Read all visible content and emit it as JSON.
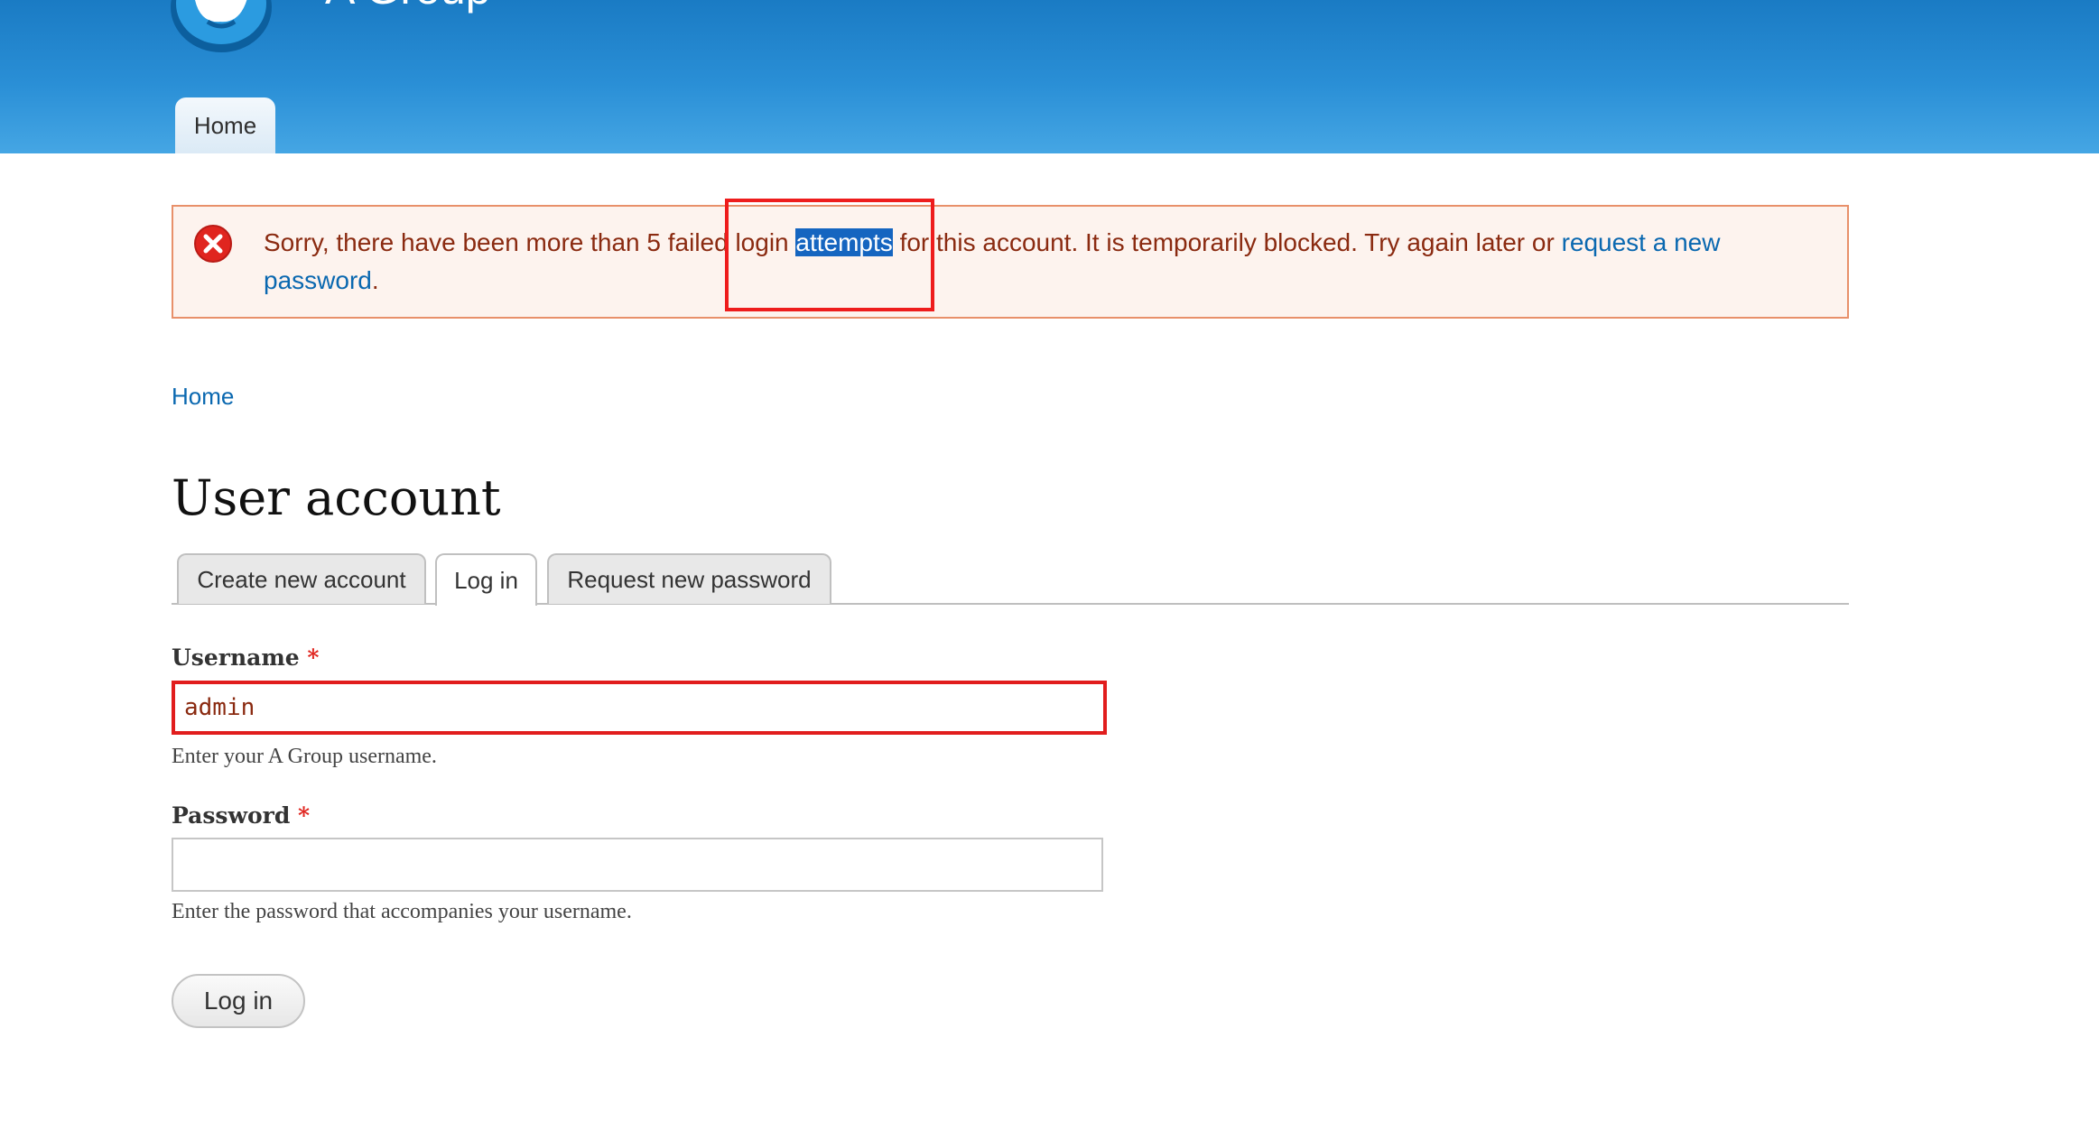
{
  "header": {
    "site_name": "A Group",
    "nav": {
      "home_label": "Home"
    }
  },
  "message": {
    "text_before": "Sorry, there have been more than 5 failed login ",
    "highlighted_word": "attempts",
    "text_after": " for this account. It is temporarily blocked. Try again later or ",
    "link_text": "request a new password",
    "text_end": "."
  },
  "breadcrumb": {
    "home": "Home"
  },
  "page": {
    "title": "User account",
    "tabs": [
      {
        "label": "Create new account"
      },
      {
        "label": "Log in"
      },
      {
        "label": "Request new password"
      }
    ]
  },
  "form": {
    "username": {
      "label": "Username",
      "required_mark": "*",
      "value": "admin",
      "help": "Enter your A Group username."
    },
    "password": {
      "label": "Password",
      "required_mark": "*",
      "value": "",
      "help": "Enter the password that accompanies your username."
    },
    "submit_label": "Log in"
  },
  "colors": {
    "header_blue": "#2a8fd6",
    "error_text": "#8a2a10",
    "link": "#0a68b0",
    "annotation_red": "#ee1c1c"
  }
}
